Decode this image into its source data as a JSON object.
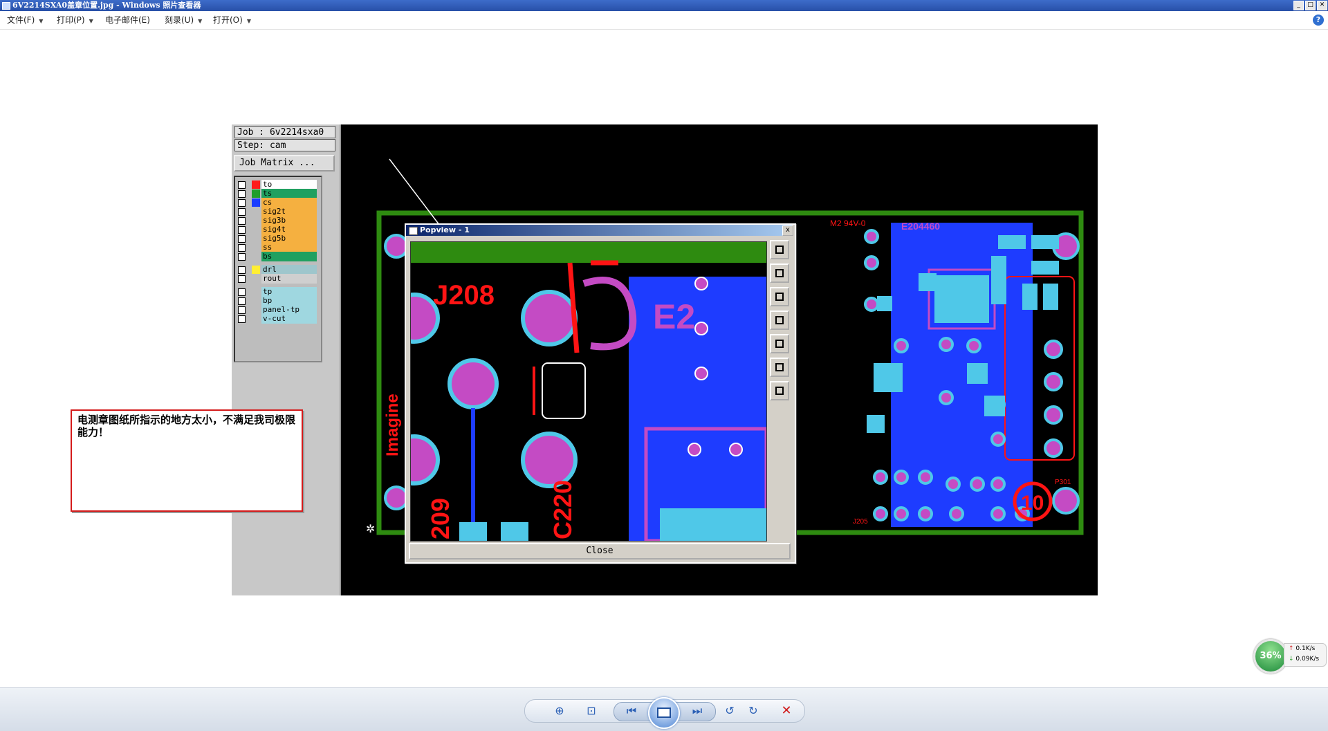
{
  "window": {
    "title": "6V2214SXA0盖章位置.jpg - Windows 照片查看器",
    "min": "_",
    "max": "□",
    "close": "✕"
  },
  "menu": [
    {
      "label": "文件(F)"
    },
    {
      "label": "打印(P)"
    },
    {
      "label": "电子邮件(E)"
    },
    {
      "label": "刻录(U)"
    },
    {
      "label": "打开(O)"
    }
  ],
  "help_label": "?",
  "cam": {
    "job": "Job : 6v2214sxa0",
    "step": "Step: cam",
    "job_matrix": "Job Matrix ...",
    "layers": [
      {
        "name": "to",
        "color": "#ff1a1a",
        "bg": "#ffffff"
      },
      {
        "name": "ts",
        "color": "#1f9e2b",
        "bg": "#20a060"
      },
      {
        "name": "cs",
        "color": "#1a3cff",
        "bg": "#f5b040"
      },
      {
        "name": "sig2t",
        "color": "",
        "bg": "#f5b040"
      },
      {
        "name": "sig3b",
        "color": "",
        "bg": "#f5b040"
      },
      {
        "name": "sig4t",
        "color": "",
        "bg": "#f5b040"
      },
      {
        "name": "sig5b",
        "color": "",
        "bg": "#f5b040"
      },
      {
        "name": "ss",
        "color": "",
        "bg": "#f5b040"
      },
      {
        "name": "bs",
        "color": "",
        "bg": "#20a060"
      },
      {
        "name": "drl",
        "color": "#ffee33",
        "bg": "#9ec6cc"
      },
      {
        "name": "rout",
        "color": "",
        "bg": "#cfcfcf"
      },
      {
        "name": "tp",
        "color": "",
        "bg": "#9fd7e0"
      },
      {
        "name": "bp",
        "color": "",
        "bg": "#9fd7e0"
      },
      {
        "name": "panel-tp",
        "color": "",
        "bg": "#9fd7e0"
      },
      {
        "name": "v-cut",
        "color": "",
        "bg": "#9fd7e0"
      }
    ],
    "board_labels": {
      "j208": "J208",
      "c220": "C220",
      "e20": "E2",
      "brand": "Imagine",
      "c209": "209",
      "m2": "M2  94V-0",
      "e204460": "E204460",
      "p301": "P301",
      "j205": "J205",
      "ten": "10"
    },
    "popup": {
      "title": "Popview - 1",
      "close_btn": "Close",
      "x": "x"
    },
    "note": "电测章图纸所指示的地方太小，不满足我司极限能力！"
  },
  "network": {
    "percent": "36%",
    "up": "0.1K/s",
    "down": "0.09K/s"
  },
  "colors": {
    "board_green": "#2e8b10",
    "copper_blue": "#1e3cff",
    "pad_magenta": "#c44bc4",
    "mask_cyan": "#4fc8e8",
    "silk_red": "#ff1414"
  }
}
